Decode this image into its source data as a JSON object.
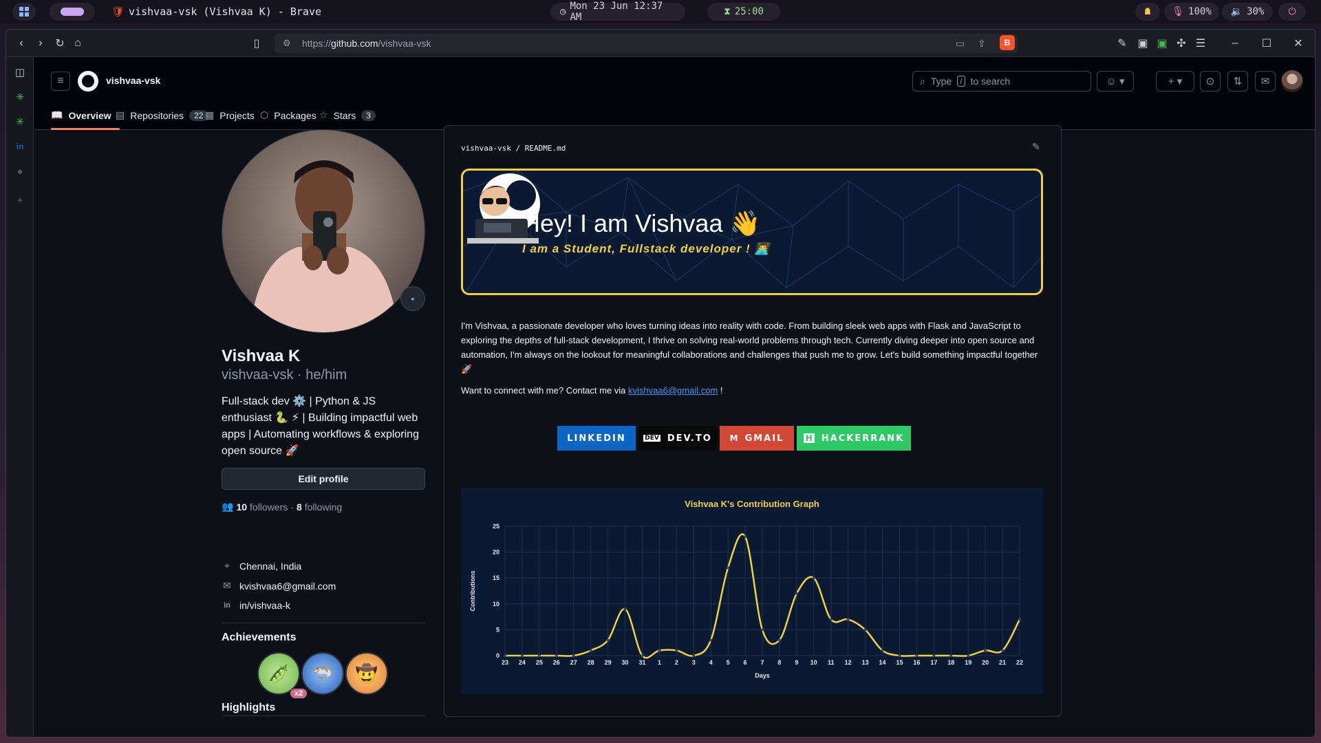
{
  "os": {
    "window_title": "vishvaa-vsk (Vishvaa K) - Brave",
    "clock": "Mon 23 Jun 12:37 AM",
    "timer": "25:00",
    "mic": "100%",
    "volume": "30%"
  },
  "browser": {
    "url_prefix": "https://",
    "url_host": "github.com",
    "url_path": "/vishvaa-vsk"
  },
  "github": {
    "username": "vishvaa-vsk",
    "search_prefix": "Type",
    "search_key": "/",
    "search_suffix": "to search",
    "tabs": [
      {
        "label": "Overview",
        "icon": "book-icon",
        "count": ""
      },
      {
        "label": "Repositories",
        "icon": "repo-icon",
        "count": "22"
      },
      {
        "label": "Projects",
        "icon": "table-icon",
        "count": ""
      },
      {
        "label": "Packages",
        "icon": "package-icon",
        "count": ""
      },
      {
        "label": "Stars",
        "icon": "star-icon",
        "count": "3"
      }
    ]
  },
  "profile": {
    "name": "Vishvaa K",
    "login_line": "vishvaa-vsk · he/him",
    "bio": "Full-stack dev ⚙️ | Python & JS enthusiast 🐍 ⚡ | Building impactful web apps | Automating workflows & exploring open source 🚀",
    "edit_label": "Edit profile",
    "followers": "10",
    "followers_label": "followers",
    "following": "8",
    "following_label": "following",
    "location": "Chennai, India",
    "email": "kvishvaa6@gmail.com",
    "linkedin": "in/vishvaa-k",
    "achievements_title": "Achievements",
    "achievement_multiplier": "x2",
    "highlights_title": "Highlights"
  },
  "readme": {
    "path_user": "vishvaa-vsk",
    "path_sep": "/",
    "path_file": "README.md",
    "banner_title": "Hey! I am Vishvaa 👋",
    "banner_subtitle": "I am a Student, Fullstack developer ! 👨‍💻",
    "intro": "I'm Vishvaa, a passionate developer who loves turning ideas into reality with code. From building sleek web apps with Flask and JavaScript to exploring the depths of full-stack development, I thrive on solving real-world problems through tech. Currently diving deeper into open source and automation, I'm always on the lookout for meaningful collaborations and challenges that push me to grow. Let's build something impactful together 🚀",
    "contact_prefix": "Want to connect with me? Contact me via",
    "contact_email": "kvishvaa6@gmail.com",
    "contact_suffix": "!",
    "socials": [
      {
        "label": "LINKEDIN",
        "color": "#0a66c2",
        "logo": ""
      },
      {
        "label": "DEV.TO",
        "color": "#0a0a0a",
        "logo": "DEV"
      },
      {
        "label": "GMAIL",
        "color": "#d14836",
        "logo": "M"
      },
      {
        "label": "HACKERRANK",
        "color": "#2ec866",
        "logo": "H"
      }
    ]
  },
  "chart_data": {
    "type": "line",
    "title": "Vishvaa K's Contribution Graph",
    "xlabel": "Days",
    "ylabel": "Contributions",
    "ylim": [
      0,
      25
    ],
    "yticks": [
      0,
      5,
      10,
      15,
      20,
      25
    ],
    "grid": true,
    "line_color": "#f4d03f",
    "categories": [
      "23",
      "24",
      "25",
      "26",
      "27",
      "28",
      "29",
      "30",
      "31",
      "1",
      "2",
      "3",
      "4",
      "5",
      "6",
      "7",
      "8",
      "9",
      "10",
      "11",
      "12",
      "13",
      "14",
      "15",
      "16",
      "17",
      "18",
      "19",
      "20",
      "21",
      "22"
    ],
    "values": [
      0,
      0,
      0,
      0,
      0,
      1,
      3,
      9,
      0,
      1,
      1,
      0,
      3,
      17,
      23,
      5,
      3,
      12,
      15,
      7,
      7,
      5,
      1,
      0,
      0,
      0,
      0,
      0,
      1,
      1,
      7
    ]
  }
}
